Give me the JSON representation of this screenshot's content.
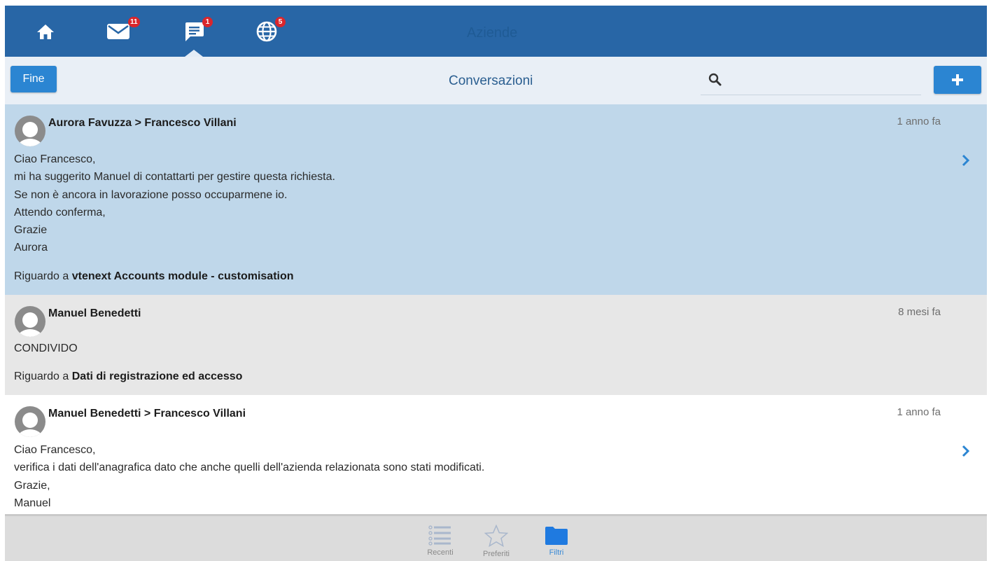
{
  "topbar": {
    "title": "Aziende",
    "nav": [
      {
        "name": "home",
        "icon": "home-icon"
      },
      {
        "name": "messages",
        "icon": "mail-icon",
        "badge": "11"
      },
      {
        "name": "conversations",
        "icon": "chat-icon",
        "badge": "1",
        "active": true
      },
      {
        "name": "web",
        "icon": "globe-icon",
        "badge": "5"
      }
    ]
  },
  "toolbar": {
    "done_label": "Fine",
    "title": "Conversazioni",
    "search_placeholder": "",
    "add_icon": "plus-icon"
  },
  "conversations": [
    {
      "author": "Aurora Favuzza > Francesco Villani",
      "time": "1 anno fa",
      "lines": [
        "Ciao Francesco,",
        "mi ha suggerito Manuel di contattarti per gestire questa richiesta.",
        "Se non è ancora in lavorazione posso occuparmene io.",
        "Attendo conferma,",
        "Grazie",
        "Aurora"
      ],
      "about_prefix": "Riguardo a",
      "about": "vtenext Accounts module - customisation"
    },
    {
      "author": "Manuel Benedetti",
      "time": "8 mesi fa",
      "lines": [
        "CONDIVIDO"
      ],
      "about_prefix": "Riguardo a",
      "about": "Dati di registrazione ed accesso"
    },
    {
      "author": "Manuel Benedetti > Francesco Villani",
      "time": "1 anno fa",
      "lines": [
        "Ciao Francesco,",
        "verifica i dati dell'anagrafica dato che anche quelli dell'azienda relazionata sono stati modificati.",
        "Grazie,",
        "Manuel"
      ]
    }
  ],
  "bottombar": {
    "items": [
      {
        "label": "Recenti",
        "icon": "list-icon"
      },
      {
        "label": "Preferiti",
        "icon": "star-icon"
      },
      {
        "label": "Filtri",
        "icon": "folder-icon",
        "active": true
      }
    ]
  },
  "colors": {
    "header": "#2866a6",
    "toolbar": "#e9eff6",
    "accent": "#2b85d2",
    "badge": "#d9262c",
    "selected_row": "#bfd7ea",
    "alt_row": "#e7e7e7"
  }
}
